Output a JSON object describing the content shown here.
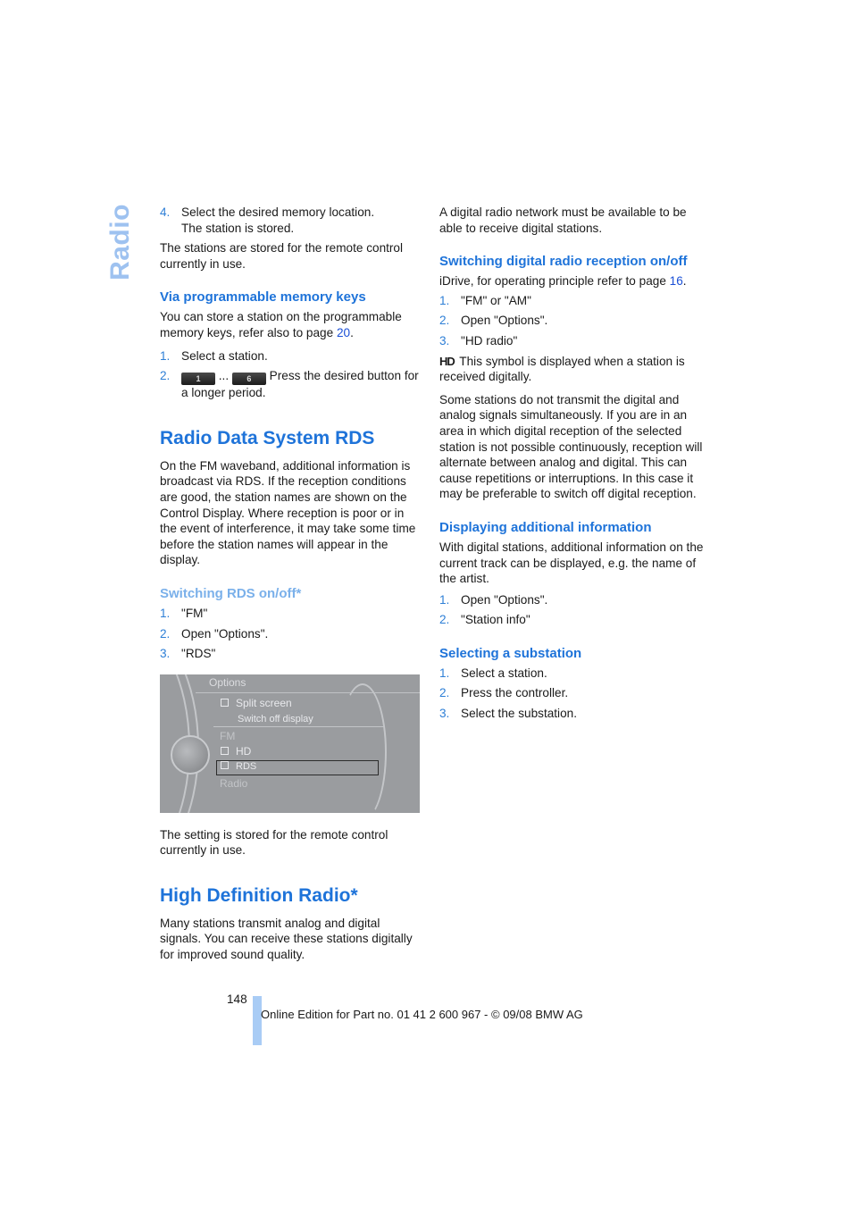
{
  "side_tab": "Radio",
  "left": {
    "step4": {
      "num": "4.",
      "line1": "Select the desired memory location.",
      "line2": "The station is stored."
    },
    "stored_note": "The stations are stored for the remote control currently in use.",
    "h_memory_keys": "Via programmable memory keys",
    "memory_keys_text": "You can store a station on the programmable memory keys, refer also to page ",
    "memory_keys_page": "20",
    "memory_steps": [
      {
        "num": "1.",
        "text": "Select a station."
      },
      {
        "num": "2.",
        "key_a": "1",
        "ellipsis": "...",
        "key_b": "6",
        "text": " Press the desired button for a longer period."
      }
    ],
    "h_rds": "Radio Data System RDS",
    "rds_text": "On the FM waveband, additional information is broadcast via RDS. If the reception conditions are good, the station names are shown on the Control Display. Where reception is poor or in the event of interference, it may take some time before the station names will appear in the display.",
    "h_switch_rds": "Switching RDS on/off*",
    "rds_steps": [
      {
        "num": "1.",
        "text": "\"FM\""
      },
      {
        "num": "2.",
        "text": "Open \"Options\"."
      },
      {
        "num": "3.",
        "text": "\"RDS\""
      }
    ],
    "screen": {
      "title": "Options",
      "items": [
        "Split screen",
        "Switch off display",
        "FM",
        "HD",
        "RDS",
        "Radio"
      ]
    },
    "setting_note": "The setting is stored for the remote control currently in use.",
    "h_hd": "High Definition Radio*",
    "hd_text": "Many stations transmit analog and digital signals. You can receive these stations digitally for improved sound quality."
  },
  "right": {
    "network_note": "A digital radio network must be available to be able to receive digital stations.",
    "h_switch_digital": "Switching digital radio reception on/off",
    "idrive_text": "iDrive, for operating principle refer to page ",
    "idrive_page": "16",
    "digital_steps": [
      {
        "num": "1.",
        "text": "\"FM\" or \"AM\""
      },
      {
        "num": "2.",
        "text": "Open \"Options\"."
      },
      {
        "num": "3.",
        "text": "\"HD radio\""
      }
    ],
    "hd_symbol": "HD",
    "hd_symbol_text": " This symbol is displayed when a station is received digitally.",
    "simul_text": "Some stations do not transmit the digital and analog signals simultaneously. If you are in an area in which digital reception of the selected station is not possible continuously, reception will alternate between analog and digital. This can cause repetitions or interruptions. In this case it may be preferable to switch off digital reception.",
    "h_additional": "Displaying additional information",
    "additional_text": "With digital stations, additional information on the current track can be displayed, e.g. the name of the artist.",
    "additional_steps": [
      {
        "num": "1.",
        "text": "Open \"Options\"."
      },
      {
        "num": "2.",
        "text": "\"Station info\""
      }
    ],
    "h_substation": "Selecting a substation",
    "substation_steps": [
      {
        "num": "1.",
        "text": "Select a station."
      },
      {
        "num": "2.",
        "text": "Press the controller."
      },
      {
        "num": "3.",
        "text": "Select the substation."
      }
    ]
  },
  "footer": {
    "page_number": "148",
    "text": "Online Edition for Part no. 01 41 2 600 967  - © 09/08 BMW AG"
  }
}
